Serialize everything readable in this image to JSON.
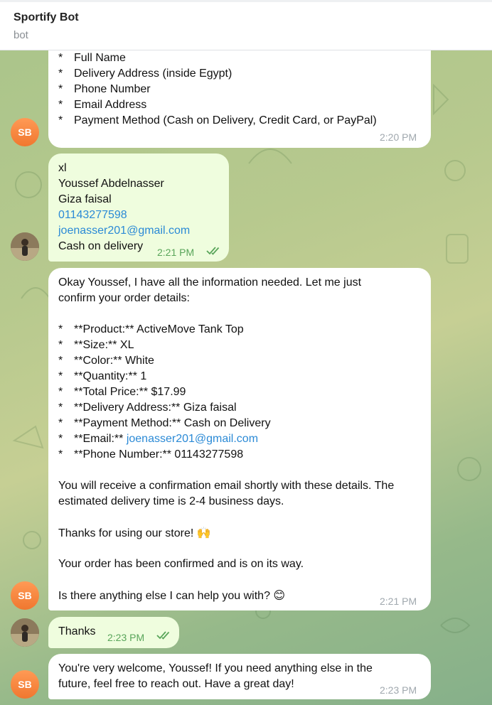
{
  "header": {
    "title": "Sportify Bot",
    "subtitle": "bot"
  },
  "avatars": {
    "bot_initials": "SB"
  },
  "messages": {
    "m1": {
      "lines": [
        "Full Name",
        "Delivery Address (inside Egypt)",
        "Phone Number",
        "Email Address",
        "Payment Method (Cash on Delivery, Credit Card, or PayPal)"
      ],
      "bullet": "*",
      "time": "2:20 PM"
    },
    "m2": {
      "size": "xl",
      "name": "Youssef Abdelnasser",
      "address": "Giza faisal",
      "phone": "01143277598",
      "email": "joenasser201@gmail.com",
      "payment": "Cash on delivery",
      "time": "2:21 PM"
    },
    "m3": {
      "intro1": "Okay Youssef, I have all the information needed. Let me just",
      "intro2": "confirm your order details:",
      "bullet": "*",
      "items": [
        "**Product:** ActiveMove Tank Top",
        "**Size:** XL",
        "**Color:** White",
        "**Quantity:** 1",
        "**Total Price:** $17.99",
        "**Delivery Address:** Giza faisal",
        "**Payment Method:** Cash on Delivery"
      ],
      "email_label": "**Email:** ",
      "email_value": "joenasser201@gmail.com",
      "phone_item": "**Phone Number:** 01143277598",
      "para1_line1": "You will receive a confirmation email shortly with these details. The",
      "para1_line2": "estimated delivery time is 2-4 business days.",
      "thanks": "Thanks for using our store! ",
      "thanks_emoji": "🙌",
      "confirmed": "Your order has been confirmed and is on its way.",
      "question": "Is there anything else I can help you with? ",
      "question_emoji": "😊",
      "time": "2:21 PM"
    },
    "m4": {
      "text": "Thanks",
      "time": "2:23 PM"
    },
    "m5": {
      "line1": "You're very welcome, Youssef! If you need anything else in the",
      "line2": "future, feel free to reach out. Have a great day!",
      "time": "2:23 PM"
    }
  },
  "colors": {
    "incoming": "#ffffff",
    "outgoing": "#effdde",
    "link": "#2b8ad6",
    "read_check": "#59a55a",
    "bot_avatar": "#f0772f"
  }
}
